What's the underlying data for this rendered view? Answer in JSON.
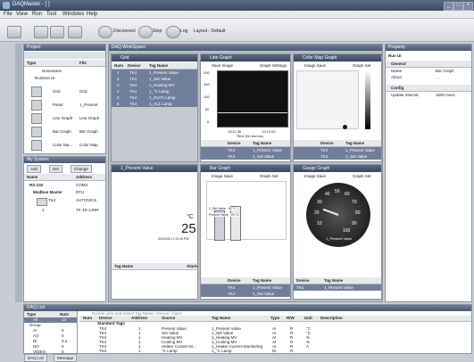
{
  "app": {
    "title": "DAQMaster - [ ]"
  },
  "menu": [
    "File",
    "View",
    "Run",
    "Tool",
    "Windows",
    "Help"
  ],
  "toolbar": {
    "disconnect": "Disconnect",
    "stop": "Stop",
    "log": "Log",
    "layout": "Layout - Default"
  },
  "project": {
    "title": "Project",
    "col_type": "Type",
    "col_file": "File",
    "nonename": "Nonename",
    "runtime": "Runtime UI",
    "items": [
      {
        "type": "Grid",
        "file": "Grid"
      },
      {
        "type": "Panel",
        "file": "1_Present"
      },
      {
        "type": "Line Graph",
        "file": "Line Graph"
      },
      {
        "type": "Bar Graph",
        "file": "Bar Graph"
      },
      {
        "type": "Color Ma...",
        "file": "Color Map"
      }
    ]
  },
  "mysystem": {
    "title": "My System",
    "tabs": [
      "Add",
      "Del",
      "Change"
    ],
    "col_name": "Name",
    "col_address": "Address",
    "rows": [
      {
        "name": "RS-232",
        "address": "COM4"
      },
      {
        "name": "Modbus Master",
        "address": "RTU"
      },
      {
        "name": "TK4",
        "address": "AUTONICS"
      },
      {
        "name": "1",
        "address": "TK 4S-14RR"
      }
    ]
  },
  "workspace": {
    "title": "DAQ WorkSpace"
  },
  "grid": {
    "title": "Grid",
    "cols": [
      "Num",
      "Device",
      "Tag Name"
    ],
    "rows": [
      [
        "1",
        "TK4",
        "1_Present Value"
      ],
      [
        "2",
        "TK4",
        "1_Set Value"
      ],
      [
        "3",
        "TK4",
        "1_Heating MV"
      ],
      [
        "4",
        "TK4",
        "1_°C Lamp"
      ],
      [
        "5",
        "TK4",
        "1_OUT1 Lamp"
      ],
      [
        "6",
        "TK4",
        "1_AL1 Lamp"
      ]
    ]
  },
  "line": {
    "title": "Line Graph",
    "save": "Save Image",
    "settings": "Graph Settings",
    "xlabel": "Time (hh:mm:ss)",
    "yticks": [
      "200",
      "150",
      "100",
      "50",
      "0"
    ],
    "xticks": [
      "13:11:30",
      "13:12:00"
    ],
    "cols": [
      "Device",
      "Tag Name"
    ],
    "rows": [
      [
        "TK4",
        "1_Present Value"
      ],
      [
        "TK4",
        "1_Set Value"
      ]
    ]
  },
  "colormap": {
    "title": "Color Map Graph",
    "save": "Image Save",
    "set": "Graph Set",
    "cols": [
      "Device",
      "Tag Name"
    ],
    "rows": [
      [
        "TK4",
        "1_Present Value"
      ],
      [
        "TK4",
        "1_Set Value"
      ]
    ]
  },
  "present": {
    "title": "1_Present Value",
    "unit": "°C",
    "value": "25",
    "datetime": "4/16/2012 1:11:10 PM",
    "cols": [
      "Tag Name",
      "Alarm"
    ]
  },
  "bar": {
    "title": "Bar Graph",
    "save": "Image Save",
    "set": "Graph Set",
    "sv_label": "1_Set Value : 30 °C",
    "pv_label": "Present Value : 25 °C",
    "cols": [
      "Device",
      "Tag Name"
    ],
    "rows": [
      [
        "TK4",
        "1_Present Value"
      ],
      [
        "TK4",
        "1_Set Value"
      ]
    ]
  },
  "gauge": {
    "title": "Gauge Graph",
    "save": "Image Save",
    "set": "Graph Set",
    "ticks": [
      "10",
      "20",
      "30",
      "40",
      "50",
      "60",
      "70",
      "80",
      "90",
      "100"
    ],
    "label": "1_Present Value",
    "cols": [
      "Device",
      "Tag Name"
    ],
    "rows": [
      [
        "TK4",
        "1_Present Value"
      ]
    ]
  },
  "property": {
    "title": "Property",
    "object": "Run UI",
    "general": "General",
    "name_label": "Name",
    "name_value": "Bar Graph",
    "about_label": "About",
    "about_value": "...",
    "config": "Config",
    "update_label": "Update Interval",
    "update_value": "1000 msec"
  },
  "daqlist": {
    "title": "DAQ List",
    "col_type": "Type",
    "col_num": "Num",
    "left_rows": [
      {
        "type": "All",
        "num": "13"
      },
      {
        "type": "Group",
        "num": ""
      },
      {
        "type": "AI",
        "num": "6"
      },
      {
        "type": "AO",
        "num": "0"
      },
      {
        "type": "DI",
        "num": "3.4"
      },
      {
        "type": "DO",
        "num": "0"
      },
      {
        "type": "VIDEO",
        "num": "0"
      }
    ],
    "hint": "Double-click and Select Tag Name / Device / Alarm",
    "cols": [
      "Num",
      "Device",
      "Address",
      "Source",
      "Tag Name",
      "Type",
      "R/W",
      "Unit",
      "Description"
    ],
    "group": "Standard Tags",
    "rows": [
      [
        "1",
        "TK4",
        "1",
        "Present Value",
        "1_Present Value",
        "AI",
        "R",
        "°C",
        ""
      ],
      [
        "2",
        "TK4",
        "1",
        "Set Value",
        "1_Set Value",
        "AI",
        "R",
        "°C",
        ""
      ],
      [
        "3",
        "TK4",
        "1",
        "Heating MV",
        "1_Heating MV",
        "AI",
        "R",
        "%",
        ""
      ],
      [
        "4",
        "TK4",
        "1",
        "Cooling MV",
        "1_Cooling MV",
        "AI",
        "R",
        "%",
        ""
      ],
      [
        "5",
        "TK4",
        "1",
        "Heater Current M...",
        "1_Heater Current Monitoring",
        "AI",
        "R",
        "A",
        ""
      ],
      [
        "6",
        "TK4",
        "1",
        "°C Lamp",
        "1_°C Lamp",
        "DI",
        "R",
        "",
        ""
      ]
    ]
  },
  "bottom_tabs": [
    "DAQ List",
    "Message"
  ]
}
